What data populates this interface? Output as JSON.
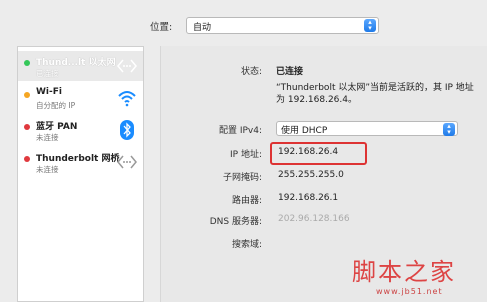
{
  "location": {
    "label": "位置:",
    "value": "自动"
  },
  "sidebar": {
    "items": [
      {
        "name": "Thund...lt 以太网",
        "status": "已连接",
        "dot": "#34c759",
        "icon": "ethernet-icon"
      },
      {
        "name": "Wi-Fi",
        "status": "自分配的 IP",
        "dot": "#f5a623",
        "icon": "wifi-icon"
      },
      {
        "name": "蓝牙 PAN",
        "status": "未连接",
        "dot": "#e0393e",
        "icon": "bluetooth-icon"
      },
      {
        "name": "Thunderbolt 网桥",
        "status": "未连接",
        "dot": "#e0393e",
        "icon": "ethernet-icon"
      }
    ]
  },
  "detail": {
    "status_label": "状态:",
    "status_value": "已连接",
    "status_desc_line1": "“Thunderbolt 以太网”当前是活跃的，其 IP 地址",
    "status_desc_line2": "为 192.168.26.4。",
    "config_label": "配置 IPv4:",
    "config_value": "使用 DHCP",
    "ip_label": "IP 地址:",
    "ip_value": "192.168.26.4",
    "subnet_label": "子网掩码:",
    "subnet_value": "255.255.255.0",
    "router_label": "路由器:",
    "router_value": "192.168.26.1",
    "dns_label": "DNS 服务器:",
    "dns_value": "202.96.128.166",
    "search_label": "搜索域:"
  },
  "watermark": {
    "text": "脚本之家",
    "url": "www.jb51.net"
  }
}
